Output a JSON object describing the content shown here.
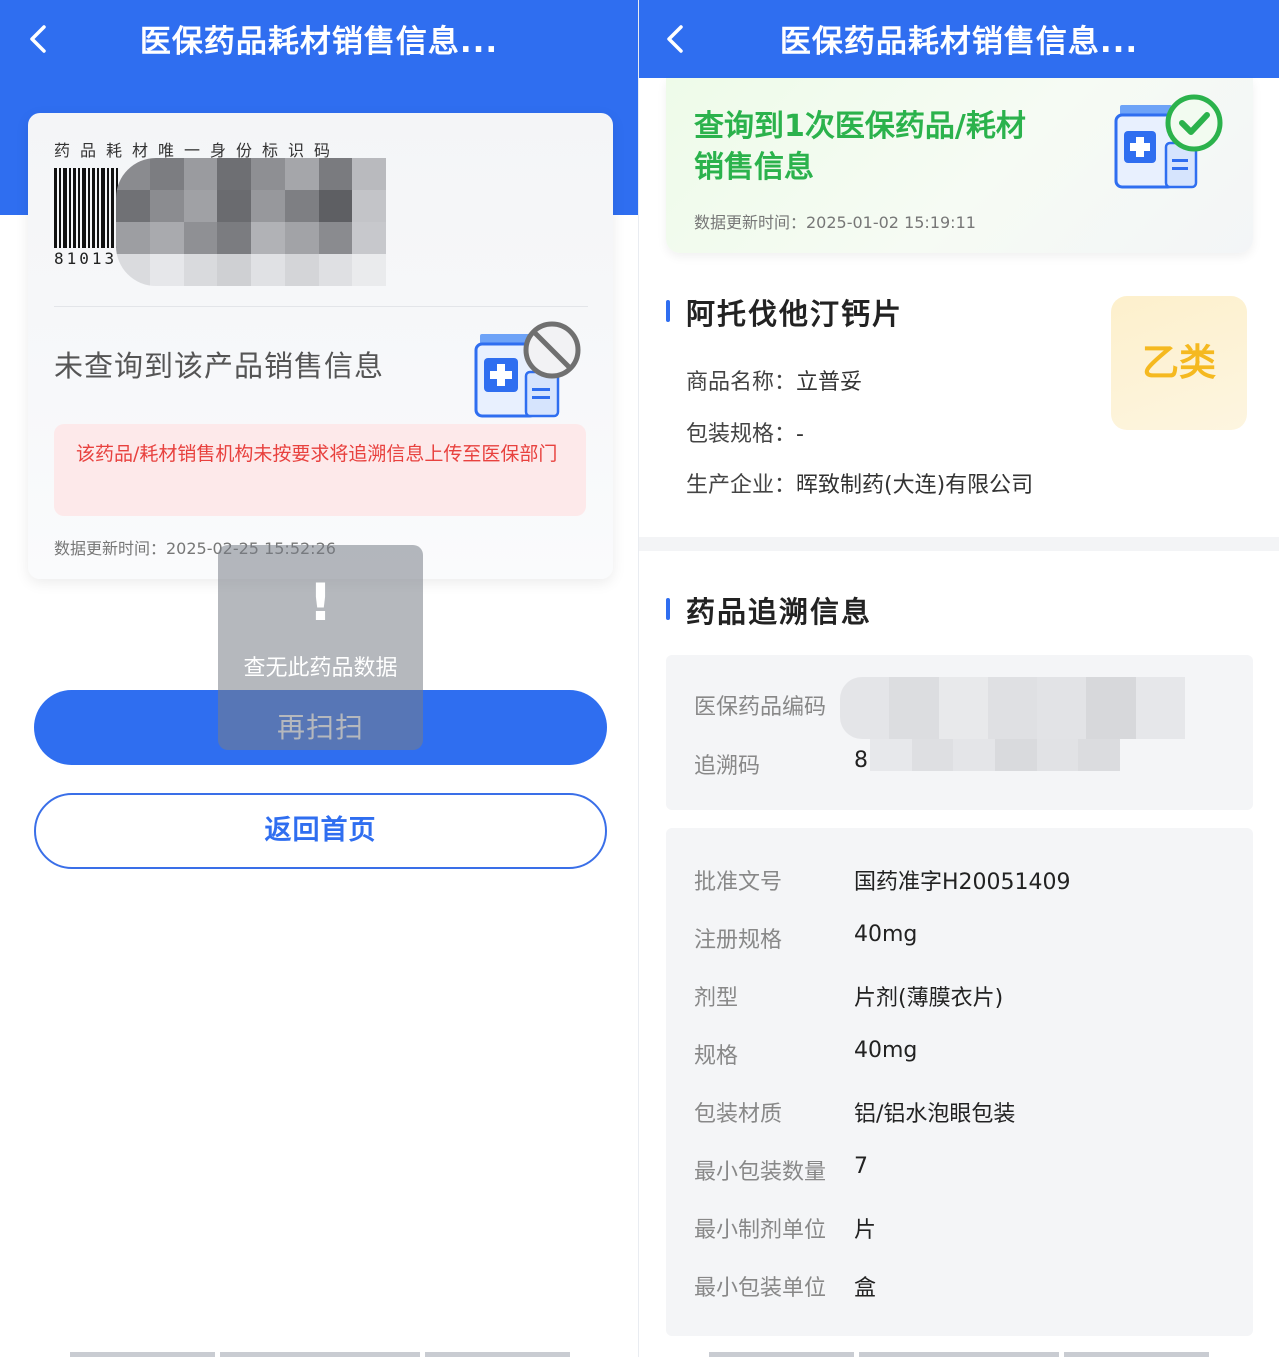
{
  "left": {
    "header": {
      "title": "医保药品耗材销售信息..."
    },
    "card": {
      "code_caption": "药品耗材唯一身份标识码",
      "barcode_number": "81013",
      "status_text": "未查询到该产品销售信息",
      "alert_text": "该药品/耗材销售机构未按要求将追溯信息上传至医保部门",
      "update_time": "数据更新时间：2025-02-25 15:52:26"
    },
    "toast": {
      "icon": "!",
      "message": "查无此药品数据"
    },
    "buttons": {
      "rescan": "再扫扫",
      "home": "返回首页"
    }
  },
  "right": {
    "header": {
      "title": "医保药品耗材销售信息..."
    },
    "result": {
      "title": "查询到1次医保药品/耗材销售信息",
      "update_time": "数据更新时间：2025-01-02 15:19:11"
    },
    "drug": {
      "name": "阿托伐他汀钙片",
      "class_badge": "乙类",
      "fields": [
        {
          "label": "商品名称：",
          "value": "立普妥"
        },
        {
          "label": "包装规格：",
          "value": "-"
        },
        {
          "label": "生产企业：",
          "value": "晖致制药(大连)有限公司"
        }
      ]
    },
    "trace": {
      "section_title": "药品追溯信息",
      "codes": [
        {
          "label": "医保药品编码",
          "value": "X"
        },
        {
          "label": "追溯码",
          "value": "81"
        }
      ],
      "details": [
        {
          "label": "批准文号",
          "value": "国药准字H20051409"
        },
        {
          "label": "注册规格",
          "value": "40mg"
        },
        {
          "label": "剂型",
          "value": "片剂(薄膜衣片)"
        },
        {
          "label": "规格",
          "value": "40mg"
        },
        {
          "label": "包装材质",
          "value": "铝/铝水泡眼包装"
        },
        {
          "label": "最小包装数量",
          "value": "7"
        },
        {
          "label": "最小制剂单位",
          "value": "片"
        },
        {
          "label": "最小包装单位",
          "value": "盒"
        }
      ]
    }
  },
  "colors": {
    "primary": "#2f6ef0",
    "success": "#2bb24c",
    "error": "#e8413e",
    "badge": "#f5b920"
  }
}
